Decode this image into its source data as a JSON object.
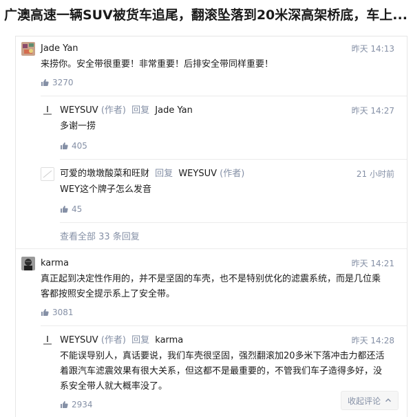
{
  "title": "广澳高速一辆SUV被货车追尾，翻滚坠落到20米深高架桥底，车上...",
  "comments": [
    {
      "author": "Jade Yan",
      "time": "昨天 14:13",
      "content": "来捞你。安全带很重要！非常重要！后排安全带同样重要！",
      "likes": "3270"
    },
    {
      "author": "WEYSUV",
      "author_tag": "(作者)",
      "reply_word": "回复",
      "reply_to": "Jade Yan",
      "time": "昨天 14:27",
      "content": "多谢一捞",
      "likes": "405"
    },
    {
      "author": "可爱的墩墩酸菜和旺财",
      "reply_word": "回复",
      "reply_to": "WEYSUV",
      "reply_to_tag": "(作者)",
      "time": "21 小时前",
      "content": "WEY这个牌子怎么发音",
      "likes": "45"
    },
    {
      "author": "karma",
      "time": "昨天 14:21",
      "content_line1": "真正起到决定性作用的，并不是坚固的车壳，也不是特别优化的滤震系统，而是几位乘",
      "content_line2": "客都按照安全提示系上了安全带。",
      "likes": "3081"
    },
    {
      "author": "WEYSUV",
      "author_tag": "(作者)",
      "reply_word": "回复",
      "reply_to": "karma",
      "time": "昨天 14:28",
      "content_line1": "不能误导别人，真话要说，我们车壳很坚固，强烈翻滚加20多米下落冲击力都还活",
      "content_line2": "着跟汽车滤震效果有很大关系，但这都不是最重要的，不管我们车子造得多好，没",
      "content_line3": "系安全带人就大概率没了。",
      "likes": "2934"
    }
  ],
  "view_all_replies": "查看全部 33 条回复",
  "collapse_label": "收起评论",
  "icons": {
    "like": "thumbs-up-icon",
    "collapse": "chevron-up-icon"
  }
}
